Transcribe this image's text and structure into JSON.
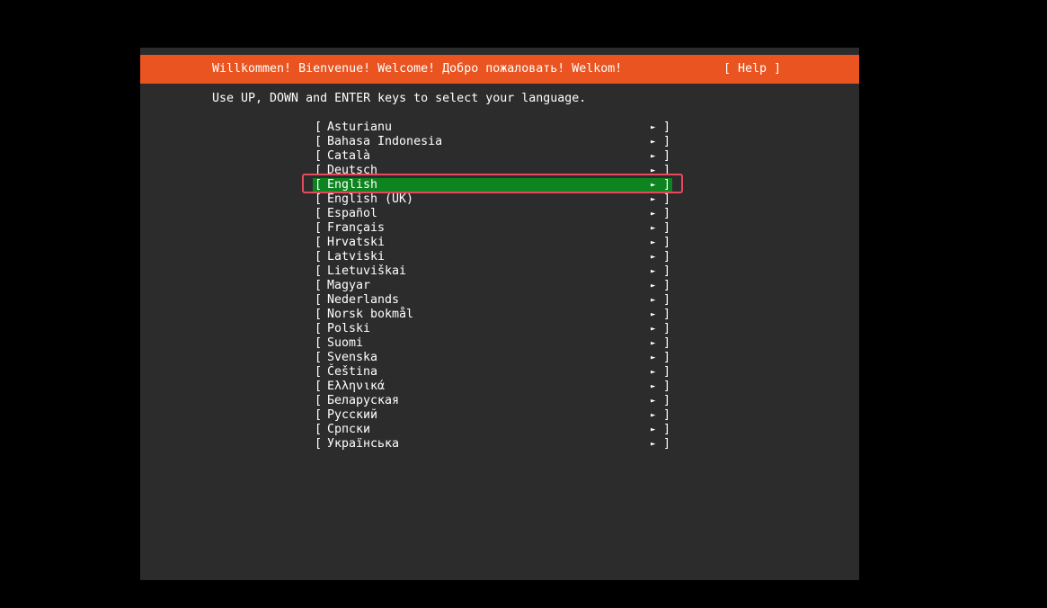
{
  "header": {
    "title": "Willkommen! Bienvenue! Welcome! Добро пожаловать! Welkom!",
    "help_label": "[ Help ]"
  },
  "instruction": "Use UP, DOWN and ENTER keys to select your language.",
  "bracket_open": "[",
  "bracket_close": "]",
  "arrow_glyph": "►",
  "languages": [
    {
      "label": "Asturianu"
    },
    {
      "label": "Bahasa Indonesia"
    },
    {
      "label": "Català"
    },
    {
      "label": "Deutsch"
    },
    {
      "label": "English",
      "selected": true
    },
    {
      "label": "English (UK)"
    },
    {
      "label": "Español"
    },
    {
      "label": "Français"
    },
    {
      "label": "Hrvatski"
    },
    {
      "label": "Latviski"
    },
    {
      "label": "Lietuviškai"
    },
    {
      "label": "Magyar"
    },
    {
      "label": "Nederlands"
    },
    {
      "label": "Norsk bokmål"
    },
    {
      "label": "Polski"
    },
    {
      "label": "Suomi"
    },
    {
      "label": "Svenska"
    },
    {
      "label": "Čeština"
    },
    {
      "label": "Ελληνικά"
    },
    {
      "label": "Беларуская"
    },
    {
      "label": "Русский"
    },
    {
      "label": "Српски"
    },
    {
      "label": "Українська"
    }
  ],
  "colors": {
    "header_bg": "#e95420",
    "screen_bg": "#2c2c2c",
    "selected_bg": "#0e8420",
    "focus_ring": "#e8495c"
  }
}
